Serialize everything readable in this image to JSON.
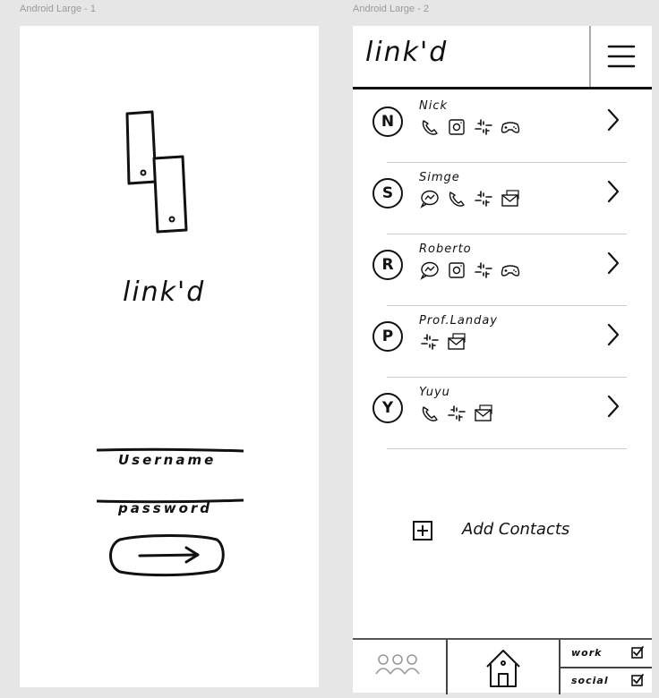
{
  "frames": {
    "login_title": "Android Large - 1",
    "contacts_title": "Android Large - 2"
  },
  "login": {
    "brand": "link'd",
    "username_label": "Username",
    "password_label": "password"
  },
  "contacts_screen": {
    "brand": "link'd",
    "contacts": [
      {
        "initial": "N",
        "name": "Nick",
        "icons": [
          "phone-icon",
          "instagram-icon",
          "slack-icon",
          "gamepad-icon"
        ]
      },
      {
        "initial": "S",
        "name": "Simge",
        "icons": [
          "messenger-icon",
          "phone-icon",
          "slack-icon",
          "email-icon"
        ]
      },
      {
        "initial": "R",
        "name": "Roberto",
        "icons": [
          "messenger-icon",
          "instagram-icon",
          "slack-icon",
          "gamepad-icon"
        ]
      },
      {
        "initial": "P",
        "name": "Prof.Landay",
        "icons": [
          "slack-icon",
          "email-icon"
        ]
      },
      {
        "initial": "Y",
        "name": "Yuyu",
        "icons": [
          "phone-icon",
          "slack-icon",
          "email-icon"
        ]
      }
    ],
    "add_contacts_label": "Add Contacts",
    "bottom_nav": {
      "filters": [
        {
          "label": "work",
          "checked": true
        },
        {
          "label": "social",
          "checked": true
        }
      ]
    }
  }
}
